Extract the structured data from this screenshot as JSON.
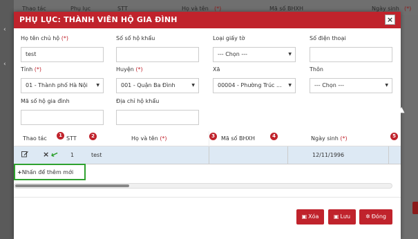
{
  "background": {
    "columns": [
      "Thao tác",
      "Phụ lục",
      "STT",
      "Họ và tên",
      "(*)",
      "Mã số BHXH",
      "Ngày sinh",
      "(*)"
    ]
  },
  "modal": {
    "title": "PHỤ LỤC: THÀNH VIÊN HỘ GIA ĐÌNH",
    "close_label": "×"
  },
  "form": {
    "ho_ten_chu_ho": {
      "label": "Họ tên chủ hộ",
      "req": "(*)",
      "value": "test"
    },
    "so_so_ho_khau": {
      "label": "Số sổ hộ khẩu",
      "value": ""
    },
    "loai_giay_to": {
      "label": "Loại giấy tờ",
      "value": "--- Chọn ---"
    },
    "so_dien_thoai": {
      "label": "Số điện thoại",
      "value": ""
    },
    "tinh": {
      "label": "Tỉnh",
      "req": "(*)",
      "value": "01 - Thành phố Hà Nội"
    },
    "huyen": {
      "label": "Huyện",
      "req": "(*)",
      "value": "001 - Quận Ba Đình"
    },
    "xa": {
      "label": "Xã",
      "value": "00004 - Phường Trúc ..."
    },
    "thon": {
      "label": "Thôn",
      "value": "--- Chọn ---"
    },
    "ma_so_ho_gia_dinh": {
      "label": "Mã số hộ gia đình",
      "value": ""
    },
    "dia_chi_ho_khau": {
      "label": "Địa chỉ hộ khẩu",
      "value": ""
    }
  },
  "table": {
    "headers": {
      "thao_tac": "Thao tác",
      "stt": "STT",
      "ho_va_ten": "Họ và tên",
      "ho_va_ten_req": "(*)",
      "ma_so_bhxh": "Mã số BHXH",
      "ngay_sinh": "Ngày sinh",
      "ngay_sinh_req": "(*)"
    },
    "badges": [
      "1",
      "2",
      "3",
      "4",
      "5"
    ],
    "rows": [
      {
        "stt": "1",
        "ho_va_ten": "test",
        "ngay_sinh": "12/11/1996"
      }
    ],
    "add_new_label": "Nhấn để thêm mới"
  },
  "buttons": {
    "delete": "Xóa",
    "save": "Lưu",
    "close": "Đóng"
  },
  "colors": {
    "accent": "#c0232c",
    "highlight_row": "#dde9f4",
    "annotation": "#2ea12e"
  }
}
